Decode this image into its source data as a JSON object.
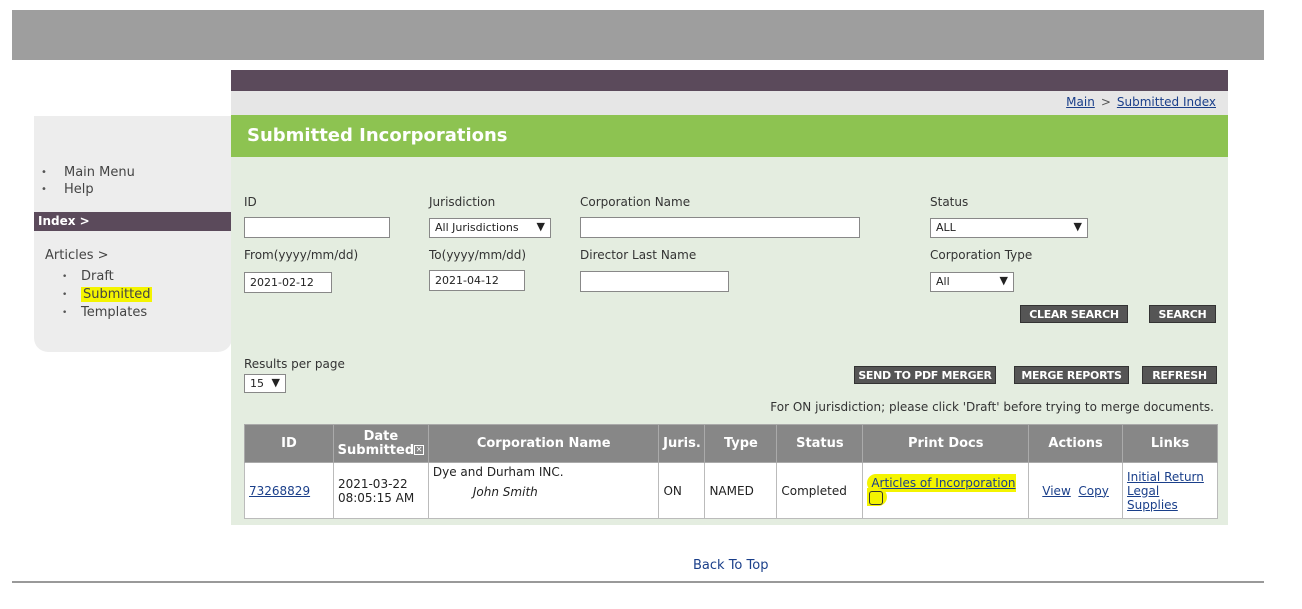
{
  "breadcrumb": {
    "main": "Main",
    "sep": ">",
    "current": "Submitted Index"
  },
  "page_title": "Submitted Incorporations",
  "sidebar": {
    "menu": [
      "Main Menu",
      "Help"
    ],
    "index_label": "Index >",
    "articles_label": "Articles >",
    "articles_items": [
      "Draft",
      "Submitted",
      "Templates"
    ]
  },
  "search": {
    "id_label": "ID",
    "id_value": "",
    "jurisdiction_label": "Jurisdiction",
    "jurisdiction_value": "All Jurisdictions",
    "corp_name_label": "Corporation Name",
    "corp_name_value": "",
    "status_label": "Status",
    "status_value": "ALL",
    "from_label": "From(yyyy/mm/dd)",
    "from_value": "2021-02-12",
    "to_label": "To(yyyy/mm/dd)",
    "to_value": "2021-04-12",
    "director_label": "Director Last Name",
    "director_value": "",
    "corp_type_label": "Corporation Type",
    "corp_type_value": "All",
    "clear_label": "CLEAR SEARCH",
    "search_label": "SEARCH"
  },
  "results": {
    "per_page_label": "Results per page",
    "per_page_value": "15",
    "send_pdf_label": "SEND TO PDF MERGER",
    "merge_reports_label": "MERGE REPORTS",
    "refresh_label": "REFRESH",
    "notice": "For ON jurisdiction; please click 'Draft' before trying to merge documents."
  },
  "table": {
    "headers": {
      "id": "ID",
      "date_line1": "Date",
      "date_line2": "Submitted",
      "corp_name": "Corporation Name",
      "juris": "Juris.",
      "type": "Type",
      "status": "Status",
      "print_docs": "Print Docs",
      "actions": "Actions",
      "links": "Links"
    },
    "rows": [
      {
        "id": "73268829",
        "date": "2021-03-22",
        "time": "08:05:15 AM",
        "corp_name": "Dye and Durham INC.",
        "contact": "John Smith",
        "juris": "ON",
        "type": "NAMED",
        "status": "Completed",
        "print_doc": "Articles of Incorporation",
        "action_view": "View",
        "action_copy": "Copy",
        "link1": "Initial Return",
        "link2": "Legal Supplies"
      }
    ]
  },
  "footer": {
    "back_to_top": "Back To Top"
  }
}
